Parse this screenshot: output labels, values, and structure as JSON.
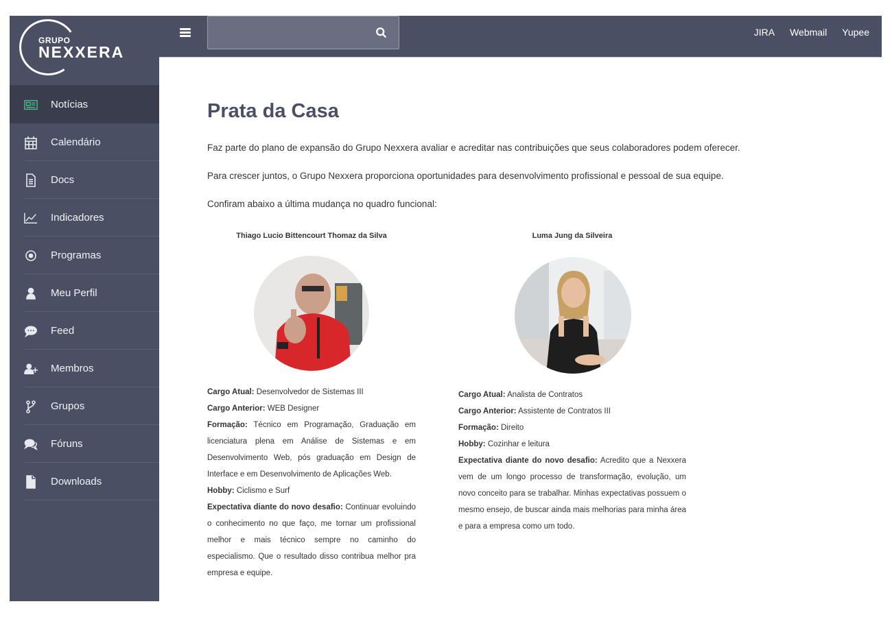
{
  "logo": {
    "line1": "GRUPO",
    "line2": "NEXXERA"
  },
  "sidebar": {
    "items": [
      {
        "label": "Notícias",
        "icon": "newspaper-icon",
        "active": true
      },
      {
        "label": "Calendário",
        "icon": "calendar-icon"
      },
      {
        "label": "Docs",
        "icon": "document-icon"
      },
      {
        "label": "Indicadores",
        "icon": "line-chart-icon"
      },
      {
        "label": "Programas",
        "icon": "dot-circle-icon"
      },
      {
        "label": "Meu Perfil",
        "icon": "user-icon"
      },
      {
        "label": "Feed",
        "icon": "comment-icon"
      },
      {
        "label": "Membros",
        "icon": "user-plus-icon"
      },
      {
        "label": "Grupos",
        "icon": "fork-icon"
      },
      {
        "label": "Fóruns",
        "icon": "comments-icon"
      },
      {
        "label": "Downloads",
        "icon": "file-icon"
      }
    ]
  },
  "topbar": {
    "search_placeholder": "",
    "links": [
      "JIRA",
      "Webmail",
      "Yupee"
    ]
  },
  "main": {
    "title": "Prata da Casa",
    "paragraphs": [
      "Faz parte do plano de expansão do Grupo Nexxera avaliar e acreditar nas contribuições que seus colaboradores podem oferecer.",
      "Para crescer juntos, o Grupo Nexxera proporciona oportunidades para desenvolvimento profissional e pessoal de sua equipe.",
      "Confiram abaixo a última mudança no quadro funcional:"
    ],
    "people": [
      {
        "name": "Thiago Lucio Bittencourt Thomaz da Silva",
        "cargo_atual_label": "Cargo Atual:",
        "cargo_atual": "Desenvolvedor de Sistemas III",
        "cargo_anterior_label": "Cargo Anterior:",
        "cargo_anterior": "WEB Designer",
        "formacao_label": "Formação:",
        "formacao": "Técnico em Programação, Graduação em licenciatura plena em Análise de Sistemas e em Desenvolvimento Web, pós graduação em Design de Interface e em Desenvolvimento de Aplicações Web.",
        "hobby_label": "Hobby:",
        "hobby": "Ciclismo e Surf",
        "expectativa_label": "Expectativa diante do novo desafio:",
        "expectativa": "Continuar evoluindo o conhecimento no que faço, me tornar um profissional melhor e mais técnico sempre no caminho do especialismo. Que o resultado disso contribua melhor pra empresa e equipe."
      },
      {
        "name": "Luma Jung da Silveira",
        "cargo_atual_label": "Cargo Atual:",
        "cargo_atual": "Analista de Contratos",
        "cargo_anterior_label": "Cargo Anterior:",
        "cargo_anterior": "Assistente de Contratos III",
        "formacao_label": "Formação:",
        "formacao": "Direito",
        "hobby_label": "Hobby:",
        "hobby": "Cozinhar e leitura",
        "expectativa_label": "Expectativa diante do novo desafio:",
        "expectativa": "Acredito que a Nexxera vem de um longo processo de transformação, evolução, um novo conceito para se trabalhar. Minhas expectativas possuem o mesmo ensejo, de buscar ainda mais melhorias para minha área e para a empresa como um todo."
      }
    ]
  },
  "colors": {
    "sidebar": "#4b4f63",
    "active_item": "#3a3d4d",
    "accent": "#4fb38b",
    "title": "#4b4f63"
  }
}
